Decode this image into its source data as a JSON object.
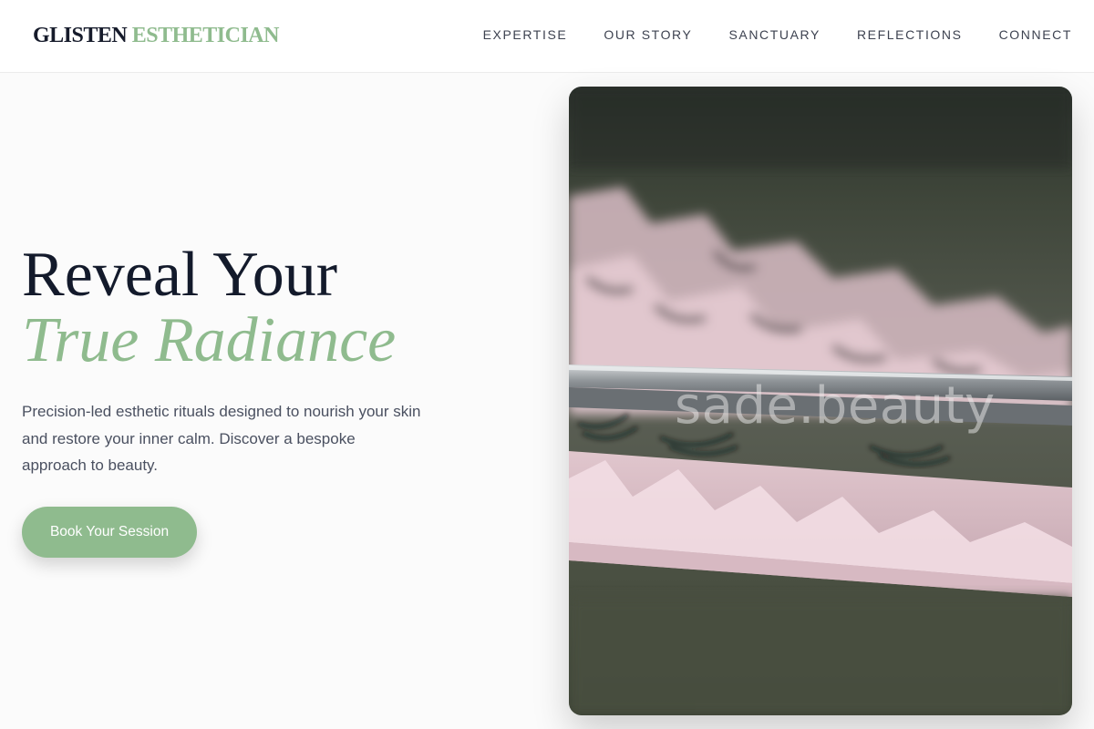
{
  "brand": {
    "word1": "GLISTEN",
    "word2": "ESTHETICIAN"
  },
  "nav": {
    "items": [
      {
        "label": "EXPERTISE"
      },
      {
        "label": "OUR STORY"
      },
      {
        "label": "SANCTUARY"
      },
      {
        "label": "REFLECTIONS"
      },
      {
        "label": "CONNECT"
      }
    ]
  },
  "hero": {
    "title_line1": "Reveal Your",
    "title_line2": "True Radiance",
    "description": "Precision-led esthetic rituals designed to nourish your skin and restore your inner calm. Discover a bespoke approach to beauty.",
    "cta_label": "Book Your Session",
    "image_watermark": "sade.beauty"
  },
  "colors": {
    "accent": "#8fbb8e",
    "heading": "#131a2b",
    "body_text": "#4a5060",
    "background": "#fbfbfb"
  }
}
